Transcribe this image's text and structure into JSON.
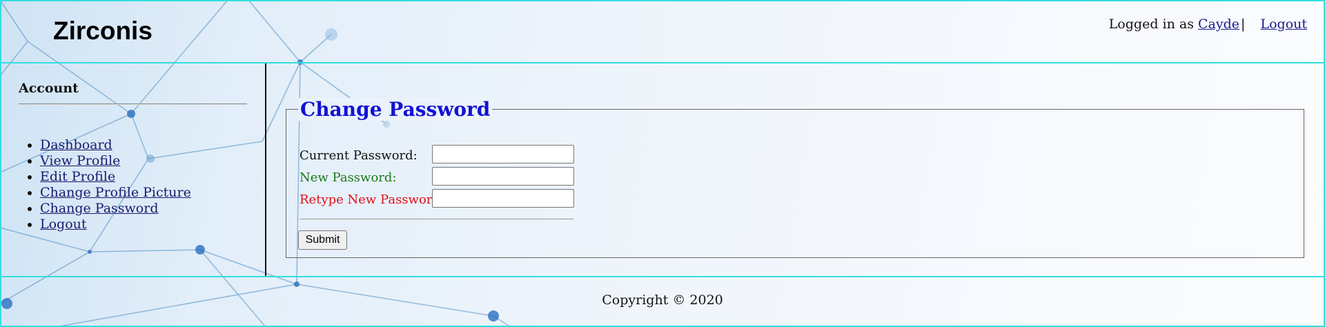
{
  "header": {
    "site_name": "Zirconis",
    "logged_in_prefix": "Logged in as",
    "username": "Cayde",
    "separator": "|",
    "logout_label": "Logout"
  },
  "sidebar": {
    "title": "Account",
    "items": [
      {
        "label": "Dashboard"
      },
      {
        "label": "View Profile"
      },
      {
        "label": "Edit Profile"
      },
      {
        "label": "Change Profile Picture"
      },
      {
        "label": "Change Password"
      },
      {
        "label": "Logout"
      }
    ]
  },
  "form": {
    "legend": "Change Password",
    "current_label": "Current Password:",
    "current_value": "",
    "new_label": "New Password:",
    "new_value": "",
    "retype_label": "Retype New Password:",
    "retype_value": "",
    "submit_label": "Submit"
  },
  "footer": {
    "copyright": "Copyright © 2020"
  },
  "colors": {
    "legend": "#1212d4",
    "new_label": "#1a7a1a",
    "retype_label": "#e0101a",
    "frame": "#33dede",
    "link": "#1a1a6e"
  }
}
